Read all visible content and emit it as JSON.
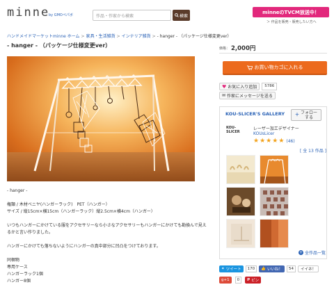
{
  "header": {
    "logo": "minne",
    "logo_sub": "by GMOペパボ",
    "search_placeholder": "作品・作家から検索",
    "search_button": "検索",
    "tvcm_badge": "minneのTVCM放送中！",
    "tvcm_sub": "＞ 作品を販売・販売したい方へ"
  },
  "breadcrumb": [
    "ハンドメイドマーケットminne ホーム",
    "家具・生活雑貨",
    "インテリア雑貨",
    "- hanger - （パッケージ仕様変更ver）"
  ],
  "product": {
    "title": "- hanger - （パッケージ仕様変更ver）",
    "price_label": "価格：",
    "price": "2,000円",
    "cart_button": "お買い物カゴに入れる",
    "favorite_label": "お気に入り追加",
    "favorite_count": "5786",
    "message_label": "作家にメッセージを送る"
  },
  "description": {
    "lines": [
      "- hanger -",
      "",
      "権類 / 木材ベニヤ(ハンガーラック)　PET（ハンガー）",
      "サイズ / 縦15cm×横15cm（ハンガーラック）縦2.5cm×横4cm（ハンガー）",
      "",
      "いつもハンガーにかけている服をアクセサリーなら小さなアクセサリーもハンガーにかけても勘換んで見えるかと言い作りました。",
      "",
      "ハンガーにかけても落ちないようにハンガーの真中部分に凹凸をつけております。",
      "",
      "同梱物",
      "専用ケース",
      "ハンガーラック1個",
      "ハンガー8個"
    ]
  },
  "gallery": {
    "title": "KOU-SLICER'S GALLERY",
    "follow_button": "フォローする",
    "creator_logo": "KOU-SLICER",
    "creator_role": "レーザー加工デザイナー",
    "creator_name": "KOUsLicer",
    "rating": 5,
    "review_count": "(46)",
    "items_count": "[ 全 13 作品 ]",
    "all_works": "全作品一覧"
  },
  "social": {
    "tweet_label": "ツイート",
    "tweet_count": "170",
    "like_label": "いいね！",
    "like_count": "54",
    "iine_label": "イイネ！",
    "gplus_label": "g+1",
    "gplus_count": "0",
    "pin_label": "ピン"
  },
  "colors": {
    "accent_orange": "#ec6a1d",
    "brand_pink": "#e2287c",
    "link_blue": "#2a62b6",
    "star_orange": "#f2a21b"
  }
}
